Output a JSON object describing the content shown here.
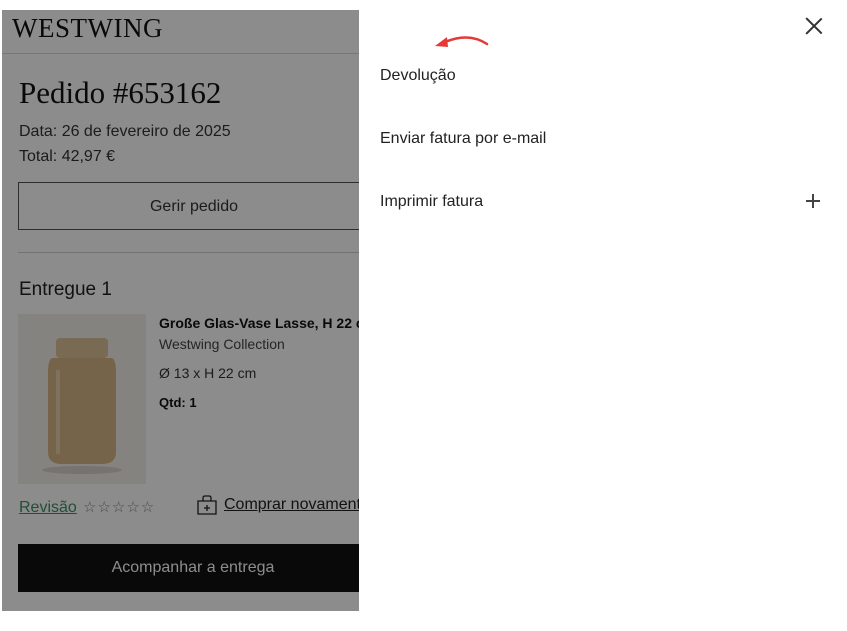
{
  "background_page": {
    "logo": "WESTWING",
    "order_title": "Pedido #653162",
    "order_date": "Data: 26 de fevereiro de 2025",
    "order_total": "Total: 42,97 €",
    "manage_button": "Gerir pedido",
    "delivered_heading": "Entregue 1",
    "product": {
      "name": "Große Glas-Vase Lasse, H 22 c",
      "brand": "Westwing Collection",
      "dimensions": "Ø 13 x H 22 cm",
      "quantity": "Qtd: 1"
    },
    "review_link": "Revisão",
    "stars": "☆☆☆☆☆",
    "buy_again": "Comprar novament",
    "track_button": "Acompanhar a entrega"
  },
  "drawer": {
    "items": [
      {
        "label": "Devolução"
      },
      {
        "label": "Enviar fatura por e-mail"
      },
      {
        "label": "Imprimir fatura",
        "icon": "plus-icon"
      }
    ],
    "close_icon": "close-icon",
    "annotation_arrow_color": "#e53935"
  },
  "colors": {
    "accent_link": "#3f8f6b",
    "primary_button": "#111111",
    "overlay": "rgba(0,0,0,0.45)"
  }
}
